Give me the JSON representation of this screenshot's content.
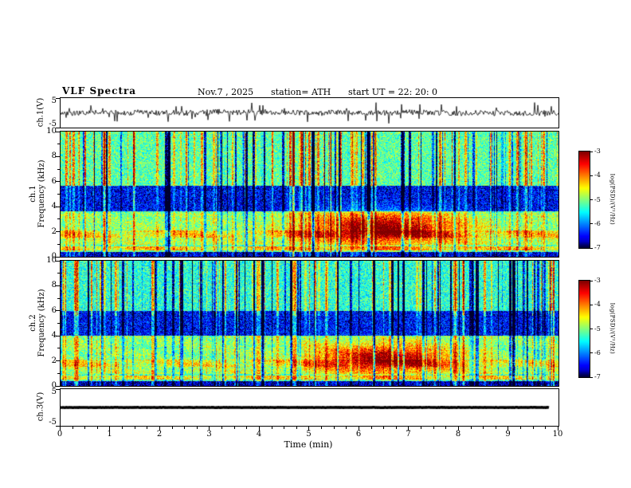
{
  "figure": {
    "background_color": "#ffffff",
    "axis_color": "#000000"
  },
  "header": {
    "title": "VLF Spectra",
    "date": "Nov.7 , 2025",
    "station": "station= ATH",
    "start_ut": "start UT = 22: 20: 0"
  },
  "labels": {
    "ch1v": "ch.1(V)",
    "ch1": "ch.1",
    "ch2": "ch.2",
    "freq": "Frequency (kHz)",
    "ch3v": "ch.3(V)"
  },
  "xaxis": {
    "label": "Time (min)",
    "min": 0,
    "max": 10,
    "ticks": [
      0,
      1,
      2,
      3,
      4,
      5,
      6,
      7,
      8,
      9,
      10
    ]
  },
  "colorbar": {
    "label": "log(PSD)/(V²/Hz)",
    "ticks": [
      -3,
      -4,
      -5,
      -6,
      -7
    ],
    "range": [
      -7,
      -3
    ]
  },
  "chart_data": [
    {
      "type": "line",
      "panel": "ch1-waveform",
      "title": "ch.1 time series",
      "ylabel": "ch.1(V)",
      "xlabel": "Time (min)",
      "xlim": [
        0,
        10
      ],
      "ylim": [
        -5,
        5
      ],
      "yticks": [
        5,
        -5
      ],
      "baseline": 0,
      "noise_amplitude": 0.9,
      "slow_wander": 0.5,
      "spike_probability": 0.055,
      "spike_amplitude": 3.2,
      "line_width": 0.8,
      "x_end": 10,
      "color": "#000000",
      "description": "broadband noise waveform fluctuating about 0 V, mostly within ±2 V, with frequent narrow spikes toward ±4 V"
    },
    {
      "type": "heatmap",
      "panel": "ch1-spectrogram",
      "title": "ch.1 VLF spectrogram",
      "ylabel": "ch.1 Frequency (kHz)",
      "xlabel": "Time (min)",
      "xlim": [
        0,
        10
      ],
      "ylim": [
        0,
        10
      ],
      "yticks": [
        0,
        2,
        4,
        6,
        8,
        10
      ],
      "zlabel": "log(PSD)/(V²/Hz)",
      "zlim": [
        -7,
        -3
      ],
      "background_level": -5.15,
      "noise_sigma": 0.55,
      "vertical_stripes": {
        "count": 150,
        "bright_offset": 1.0,
        "dark_offset": -1.6,
        "bright_fraction": 0.55
      },
      "horizontal_bands": [
        {
          "f_range": [
            3.6,
            5.7
          ],
          "level_offset": -1.35,
          "note": "dark blue low-power band"
        },
        {
          "f_range": [
            2.1,
            3.5
          ],
          "level_offset": 0.25
        },
        {
          "f_range": [
            1.5,
            2.1
          ],
          "level_offset": 0.85,
          "note": "persistent yellow-orange band near 2 kHz"
        },
        {
          "f_range": [
            0.95,
            1.5
          ],
          "level_offset": 0.45
        },
        {
          "f_range": [
            0.5,
            0.8
          ],
          "level_offset": 0.9
        },
        {
          "f_range": [
            0.0,
            0.4
          ],
          "level_offset": -1.5,
          "note": "dark bottom strip"
        }
      ],
      "emission": {
        "t_range": [
          4.7,
          7.8
        ],
        "t_peak": 6.5,
        "f_range": [
          0.9,
          3.5
        ],
        "f_peak": 2.3,
        "peak_level": -3.0,
        "note": "strong red emission patch ~5-7.5 min below 3.5 kHz"
      }
    },
    {
      "type": "heatmap",
      "panel": "ch2-spectrogram",
      "title": "ch.2 VLF spectrogram",
      "ylabel": "ch.2 Frequency (kHz)",
      "xlabel": "Time (min)",
      "xlim": [
        0,
        10
      ],
      "ylim": [
        0,
        10
      ],
      "yticks": [
        0,
        2,
        4,
        6,
        8,
        10
      ],
      "zlabel": "log(PSD)/(V²/Hz)",
      "zlim": [
        -7,
        -3
      ],
      "background_level": -5.2,
      "noise_sigma": 0.55,
      "vertical_stripes": {
        "count": 150,
        "bright_offset": 1.0,
        "dark_offset": -1.6,
        "bright_fraction": 0.5
      },
      "horizontal_bands": [
        {
          "f_range": [
            4.0,
            6.0
          ],
          "level_offset": -1.25,
          "note": "dark blue low-power band"
        },
        {
          "f_range": [
            6.0,
            10.0
          ],
          "level_offset": -0.15
        },
        {
          "f_range": [
            2.1,
            4.0
          ],
          "level_offset": 0.3
        },
        {
          "f_range": [
            1.5,
            2.1
          ],
          "level_offset": 0.8,
          "note": "persistent yellow-orange band near 2 kHz"
        },
        {
          "f_range": [
            0.95,
            1.5
          ],
          "level_offset": 0.5
        },
        {
          "f_range": [
            0.5,
            0.8
          ],
          "level_offset": 0.85
        },
        {
          "f_range": [
            0.0,
            0.4
          ],
          "level_offset": -1.5,
          "note": "dark bottom strip"
        }
      ],
      "emission": {
        "t_range": [
          4.9,
          7.7
        ],
        "t_peak": 6.5,
        "f_range": [
          1.0,
          3.3
        ],
        "f_peak": 2.2,
        "peak_level": -3.2,
        "note": "strong red emission patch ~5-7.5 min below 3.3 kHz"
      }
    },
    {
      "type": "line",
      "panel": "ch3-waveform",
      "title": "ch.3 time series",
      "ylabel": "ch.3(V)",
      "xlabel": "Time (min)",
      "xlim": [
        0,
        10
      ],
      "ylim": [
        -5,
        5
      ],
      "yticks": [
        5,
        -5
      ],
      "baseline": 0,
      "noise_amplitude": 0.05,
      "slow_wander": 0,
      "spike_probability": 0,
      "spike_amplitude": 0,
      "line_width": 3.5,
      "x_end": 9.8,
      "color": "#000000",
      "description": "flat thick black trace at 0 V for the whole record"
    }
  ]
}
